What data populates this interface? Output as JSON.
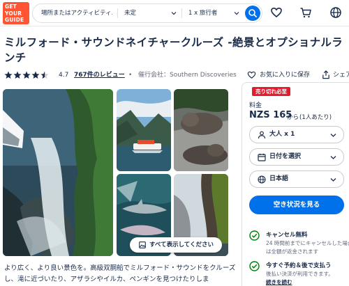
{
  "header": {
    "logo_lines": [
      "GET",
      "YOUR",
      "GUIDE"
    ],
    "search": {
      "place_placeholder": "場所またはアクティビティ…",
      "date_value": "未定",
      "travelers_value": "1 x 旅行者"
    },
    "icons": [
      "heart-icon",
      "cart-icon",
      "globe-icon"
    ],
    "brand_color": "#ff5533",
    "accent_color": "#0071eb"
  },
  "activity": {
    "title": "ミルフォード・サウンドネイチャークルーズ -絶景とオプショナルランチ",
    "rating": "4.7",
    "rating_stars": 4.5,
    "reviews": "767件のレビュー",
    "separator": "•",
    "operator": "催行会社：Southern Discoveries",
    "wishlist_label": "お気に入りに保存",
    "share_label": "シェア"
  },
  "gallery": {
    "show_all_label": "すべて表示してください"
  },
  "description": "より広く、より良い景色を。高級双胴船でミルフォード・サウンドをクルーズし、滝に近づいたり、アザラシやイルカ、ペンギンを見つけたりしま",
  "booking": {
    "badge": "売り切れ必至",
    "price_label": "料金",
    "price": "NZS 165",
    "price_from": "から",
    "price_per": "(1人あたり)",
    "selectors": {
      "travelers": "大人 x 1",
      "date": "日付を選択",
      "language": "日本語"
    },
    "check_button": "空き状況を見る",
    "features": [
      {
        "title": "キャンセル無料",
        "text": "24 時間前までにキャンセルした場合は全額が返金されます"
      },
      {
        "title": "今すぐ予約＆後で支払う",
        "text": "後払い決済が利用できます。",
        "link": "続きを読む"
      }
    ],
    "success_color": "#008009",
    "badge_color": "#e31c2d"
  }
}
